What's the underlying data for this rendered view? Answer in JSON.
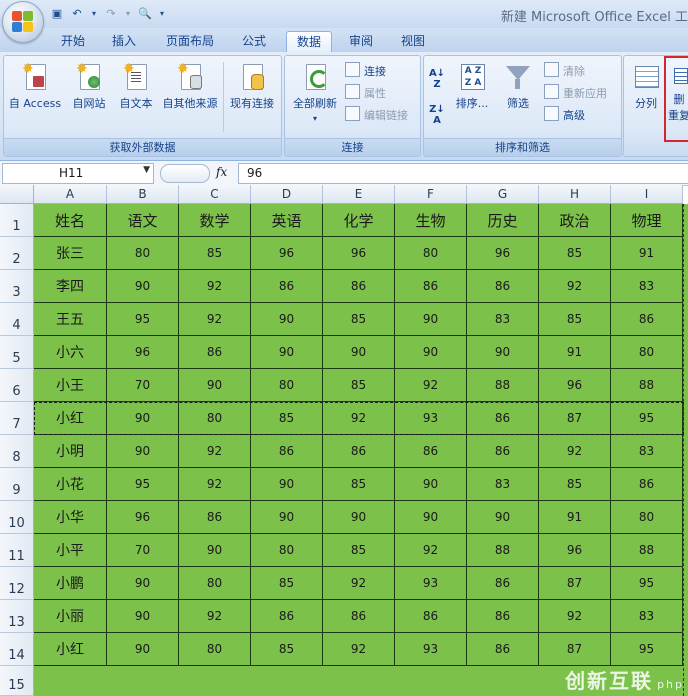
{
  "window": {
    "title": "新建 Microsoft Office Excel 工"
  },
  "quick_access": [
    "save-icon",
    "undo-icon",
    "redo-icon",
    "print-preview-icon",
    "customize-icon"
  ],
  "tabs": [
    "开始",
    "插入",
    "页面布局",
    "公式",
    "数据",
    "审阅",
    "视图"
  ],
  "active_tab": "数据",
  "ribbon": {
    "external": {
      "label": "获取外部数据",
      "buttons": [
        "自 Access",
        "自网站",
        "自文本",
        "自其他来源",
        "现有连接"
      ]
    },
    "connections": {
      "label": "连接",
      "refresh": "全部刷新",
      "items": [
        "连接",
        "属性",
        "编辑链接"
      ]
    },
    "sort_filter": {
      "label": "排序和筛选",
      "sort": "排序...",
      "filter": "筛选",
      "items": [
        "清除",
        "重新应用",
        "高级"
      ]
    },
    "tools": {
      "split": "分列",
      "dedupe_top": "删",
      "dedupe_bottom": "重复"
    }
  },
  "formula_bar": {
    "cell": "H11",
    "fx": "fx",
    "value": "96"
  },
  "columns": [
    "A",
    "B",
    "C",
    "D",
    "E",
    "F",
    "G",
    "H",
    "I"
  ],
  "rows": [
    "1",
    "2",
    "3",
    "4",
    "5",
    "6",
    "7",
    "8",
    "9",
    "10",
    "11",
    "12",
    "13",
    "14",
    "15"
  ],
  "table": {
    "headers": [
      "姓名",
      "语文",
      "数学",
      "英语",
      "化学",
      "生物",
      "历史",
      "政治",
      "物理"
    ],
    "records": [
      [
        "张三",
        "80",
        "85",
        "96",
        "96",
        "80",
        "96",
        "85",
        "91"
      ],
      [
        "李四",
        "90",
        "92",
        "86",
        "86",
        "86",
        "86",
        "92",
        "83"
      ],
      [
        "王五",
        "95",
        "92",
        "90",
        "85",
        "90",
        "83",
        "85",
        "86"
      ],
      [
        "小六",
        "96",
        "86",
        "90",
        "90",
        "90",
        "90",
        "91",
        "80"
      ],
      [
        "小王",
        "70",
        "90",
        "80",
        "85",
        "92",
        "88",
        "96",
        "88"
      ],
      [
        "小红",
        "90",
        "80",
        "85",
        "92",
        "93",
        "86",
        "87",
        "95"
      ],
      [
        "小明",
        "90",
        "92",
        "86",
        "86",
        "86",
        "86",
        "92",
        "83"
      ],
      [
        "小花",
        "95",
        "92",
        "90",
        "85",
        "90",
        "83",
        "85",
        "86"
      ],
      [
        "小华",
        "96",
        "86",
        "90",
        "90",
        "90",
        "90",
        "91",
        "80"
      ],
      [
        "小平",
        "70",
        "90",
        "80",
        "85",
        "92",
        "88",
        "96",
        "88"
      ],
      [
        "小鹏",
        "90",
        "80",
        "85",
        "92",
        "93",
        "86",
        "87",
        "95"
      ],
      [
        "小丽",
        "90",
        "92",
        "86",
        "86",
        "86",
        "86",
        "92",
        "83"
      ],
      [
        "小红",
        "90",
        "80",
        "85",
        "92",
        "93",
        "86",
        "87",
        "95"
      ]
    ]
  },
  "colors": {
    "cell_fill": "#7cc14a",
    "ribbon": "#dce8f7",
    "tab_text": "#15428b"
  },
  "watermark": {
    "brand": "创新互联",
    "tag": "php"
  }
}
